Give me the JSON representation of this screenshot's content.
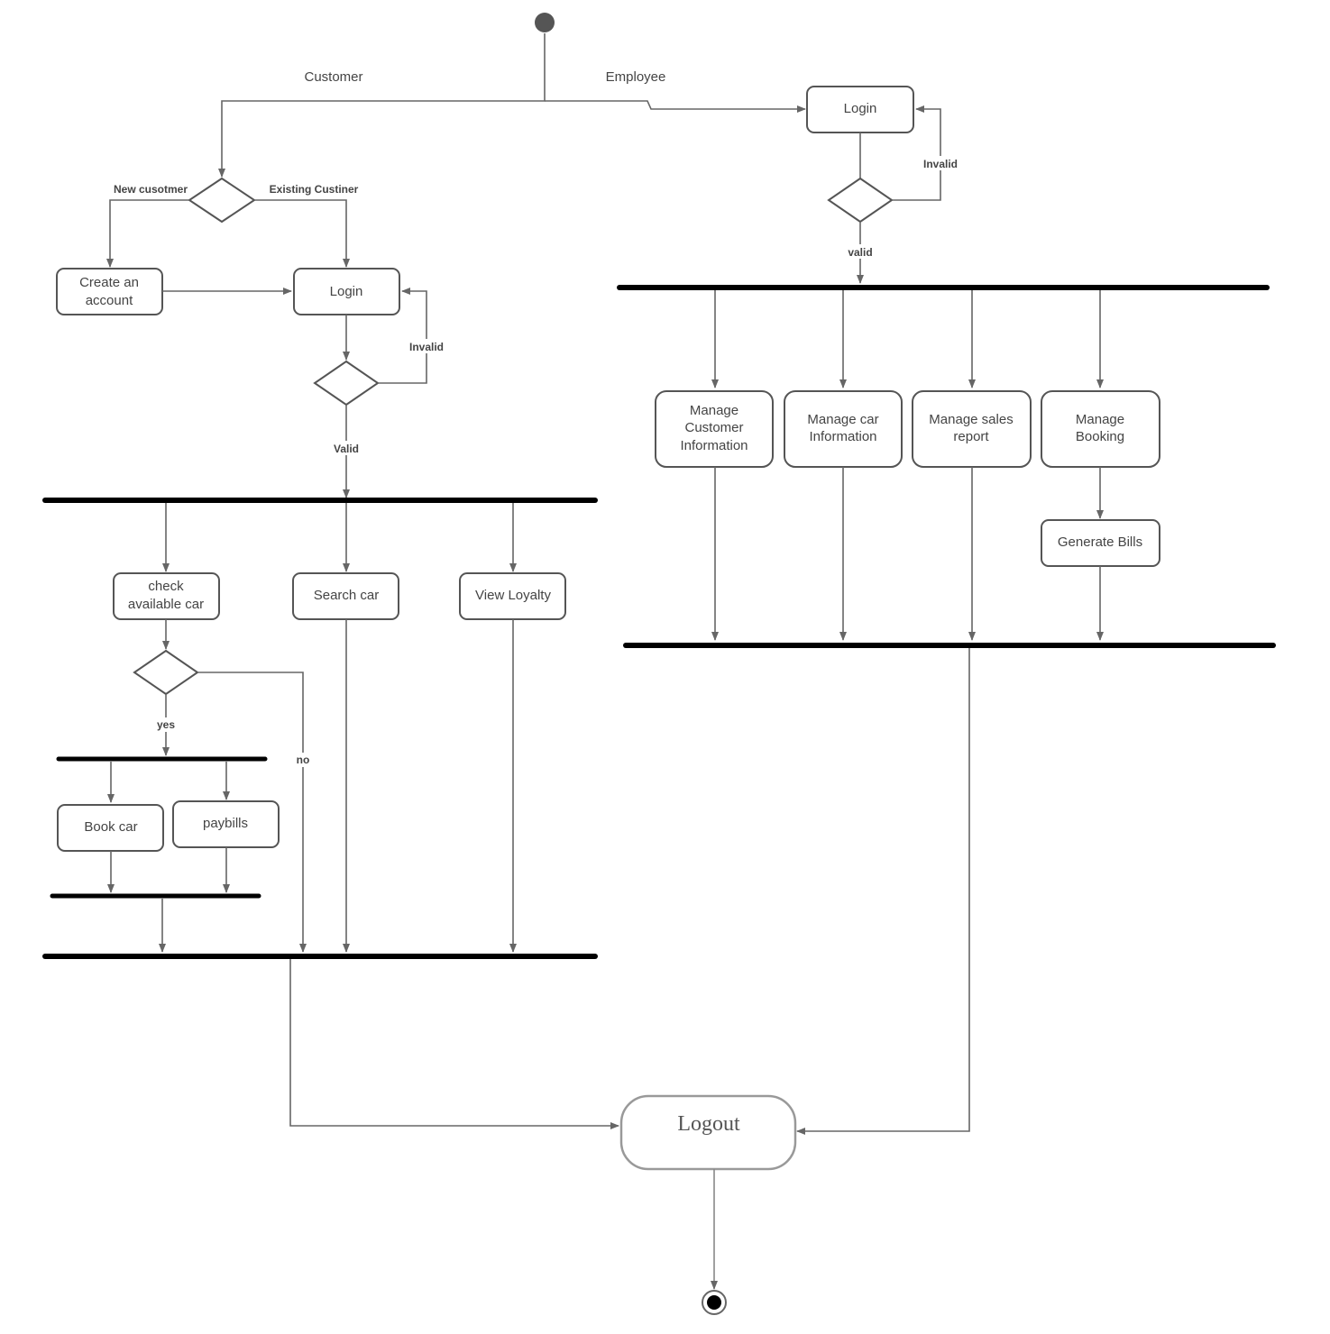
{
  "lanes": {
    "customer": "Customer",
    "employee": "Employee"
  },
  "customer": {
    "decision_new": "New cusotmer",
    "decision_existing": "Existing Custiner",
    "create_account": [
      "Create an",
      "account"
    ],
    "login": "Login",
    "invalid": "Invalid",
    "valid": "Valid",
    "check_car": [
      "check",
      "available car"
    ],
    "search_car": "Search car",
    "view_loyalty": "View Loyalty",
    "yes": "yes",
    "no": "no",
    "book_car": "Book car",
    "paybills": "paybills"
  },
  "employee": {
    "login": "Login",
    "invalid": "Invalid",
    "valid": "valid",
    "manage_customer": [
      "Manage",
      "Customer",
      "Information"
    ],
    "manage_car": [
      "Manage car",
      "Information"
    ],
    "manage_sales": [
      "Manage sales",
      "report"
    ],
    "manage_booking": [
      "Manage",
      "Booking"
    ],
    "generate_bills": "Generate Bills"
  },
  "logout": "Logout",
  "colors": {
    "line": "#666666",
    "bar": "#000000",
    "logout_border": "#999999"
  }
}
